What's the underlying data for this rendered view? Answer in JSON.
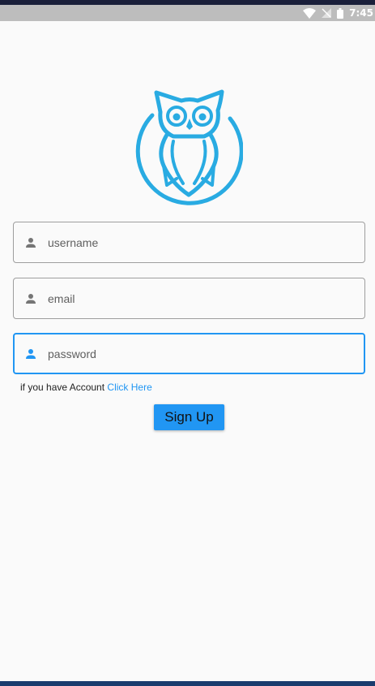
{
  "status_bar": {
    "time": "7:45",
    "icons": [
      "wifi-icon",
      "no-signal-icon",
      "battery-icon"
    ]
  },
  "logo": {
    "icon": "owl-logo-icon",
    "color": "#29abe2"
  },
  "form": {
    "username": {
      "placeholder": "username",
      "value": "",
      "icon": "person-icon"
    },
    "email": {
      "placeholder": "email",
      "value": "",
      "icon": "person-icon"
    },
    "password": {
      "placeholder": "password",
      "value": "",
      "icon": "person-icon",
      "focused": true
    }
  },
  "account": {
    "text": "if you have Account ",
    "link_label": "Click Here"
  },
  "signup_label": "Sign Up",
  "colors": {
    "accent": "#2196f3",
    "icon_default": "#757575",
    "background": "#fafafa",
    "status_bar": "#bdbdbd"
  }
}
